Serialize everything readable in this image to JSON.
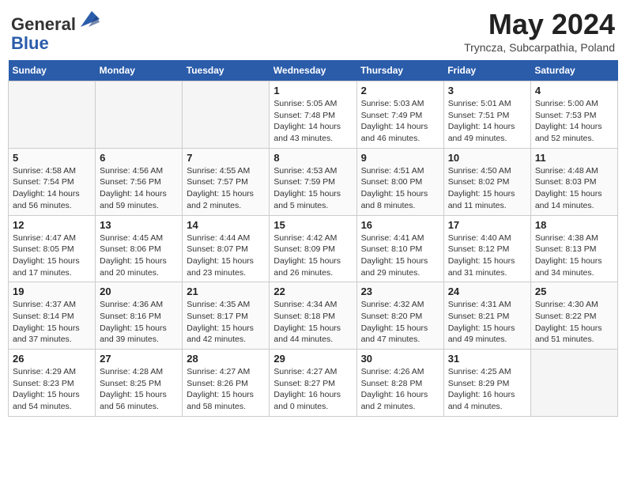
{
  "header": {
    "logo_line1": "General",
    "logo_line2": "Blue",
    "month": "May 2024",
    "location": "Tryncza, Subcarpathia, Poland"
  },
  "days_of_week": [
    "Sunday",
    "Monday",
    "Tuesday",
    "Wednesday",
    "Thursday",
    "Friday",
    "Saturday"
  ],
  "weeks": [
    [
      {
        "day": "",
        "info": ""
      },
      {
        "day": "",
        "info": ""
      },
      {
        "day": "",
        "info": ""
      },
      {
        "day": "1",
        "info": "Sunrise: 5:05 AM\nSunset: 7:48 PM\nDaylight: 14 hours\nand 43 minutes."
      },
      {
        "day": "2",
        "info": "Sunrise: 5:03 AM\nSunset: 7:49 PM\nDaylight: 14 hours\nand 46 minutes."
      },
      {
        "day": "3",
        "info": "Sunrise: 5:01 AM\nSunset: 7:51 PM\nDaylight: 14 hours\nand 49 minutes."
      },
      {
        "day": "4",
        "info": "Sunrise: 5:00 AM\nSunset: 7:53 PM\nDaylight: 14 hours\nand 52 minutes."
      }
    ],
    [
      {
        "day": "5",
        "info": "Sunrise: 4:58 AM\nSunset: 7:54 PM\nDaylight: 14 hours\nand 56 minutes."
      },
      {
        "day": "6",
        "info": "Sunrise: 4:56 AM\nSunset: 7:56 PM\nDaylight: 14 hours\nand 59 minutes."
      },
      {
        "day": "7",
        "info": "Sunrise: 4:55 AM\nSunset: 7:57 PM\nDaylight: 15 hours\nand 2 minutes."
      },
      {
        "day": "8",
        "info": "Sunrise: 4:53 AM\nSunset: 7:59 PM\nDaylight: 15 hours\nand 5 minutes."
      },
      {
        "day": "9",
        "info": "Sunrise: 4:51 AM\nSunset: 8:00 PM\nDaylight: 15 hours\nand 8 minutes."
      },
      {
        "day": "10",
        "info": "Sunrise: 4:50 AM\nSunset: 8:02 PM\nDaylight: 15 hours\nand 11 minutes."
      },
      {
        "day": "11",
        "info": "Sunrise: 4:48 AM\nSunset: 8:03 PM\nDaylight: 15 hours\nand 14 minutes."
      }
    ],
    [
      {
        "day": "12",
        "info": "Sunrise: 4:47 AM\nSunset: 8:05 PM\nDaylight: 15 hours\nand 17 minutes."
      },
      {
        "day": "13",
        "info": "Sunrise: 4:45 AM\nSunset: 8:06 PM\nDaylight: 15 hours\nand 20 minutes."
      },
      {
        "day": "14",
        "info": "Sunrise: 4:44 AM\nSunset: 8:07 PM\nDaylight: 15 hours\nand 23 minutes."
      },
      {
        "day": "15",
        "info": "Sunrise: 4:42 AM\nSunset: 8:09 PM\nDaylight: 15 hours\nand 26 minutes."
      },
      {
        "day": "16",
        "info": "Sunrise: 4:41 AM\nSunset: 8:10 PM\nDaylight: 15 hours\nand 29 minutes."
      },
      {
        "day": "17",
        "info": "Sunrise: 4:40 AM\nSunset: 8:12 PM\nDaylight: 15 hours\nand 31 minutes."
      },
      {
        "day": "18",
        "info": "Sunrise: 4:38 AM\nSunset: 8:13 PM\nDaylight: 15 hours\nand 34 minutes."
      }
    ],
    [
      {
        "day": "19",
        "info": "Sunrise: 4:37 AM\nSunset: 8:14 PM\nDaylight: 15 hours\nand 37 minutes."
      },
      {
        "day": "20",
        "info": "Sunrise: 4:36 AM\nSunset: 8:16 PM\nDaylight: 15 hours\nand 39 minutes."
      },
      {
        "day": "21",
        "info": "Sunrise: 4:35 AM\nSunset: 8:17 PM\nDaylight: 15 hours\nand 42 minutes."
      },
      {
        "day": "22",
        "info": "Sunrise: 4:34 AM\nSunset: 8:18 PM\nDaylight: 15 hours\nand 44 minutes."
      },
      {
        "day": "23",
        "info": "Sunrise: 4:32 AM\nSunset: 8:20 PM\nDaylight: 15 hours\nand 47 minutes."
      },
      {
        "day": "24",
        "info": "Sunrise: 4:31 AM\nSunset: 8:21 PM\nDaylight: 15 hours\nand 49 minutes."
      },
      {
        "day": "25",
        "info": "Sunrise: 4:30 AM\nSunset: 8:22 PM\nDaylight: 15 hours\nand 51 minutes."
      }
    ],
    [
      {
        "day": "26",
        "info": "Sunrise: 4:29 AM\nSunset: 8:23 PM\nDaylight: 15 hours\nand 54 minutes."
      },
      {
        "day": "27",
        "info": "Sunrise: 4:28 AM\nSunset: 8:25 PM\nDaylight: 15 hours\nand 56 minutes."
      },
      {
        "day": "28",
        "info": "Sunrise: 4:27 AM\nSunset: 8:26 PM\nDaylight: 15 hours\nand 58 minutes."
      },
      {
        "day": "29",
        "info": "Sunrise: 4:27 AM\nSunset: 8:27 PM\nDaylight: 16 hours\nand 0 minutes."
      },
      {
        "day": "30",
        "info": "Sunrise: 4:26 AM\nSunset: 8:28 PM\nDaylight: 16 hours\nand 2 minutes."
      },
      {
        "day": "31",
        "info": "Sunrise: 4:25 AM\nSunset: 8:29 PM\nDaylight: 16 hours\nand 4 minutes."
      },
      {
        "day": "",
        "info": ""
      }
    ]
  ]
}
